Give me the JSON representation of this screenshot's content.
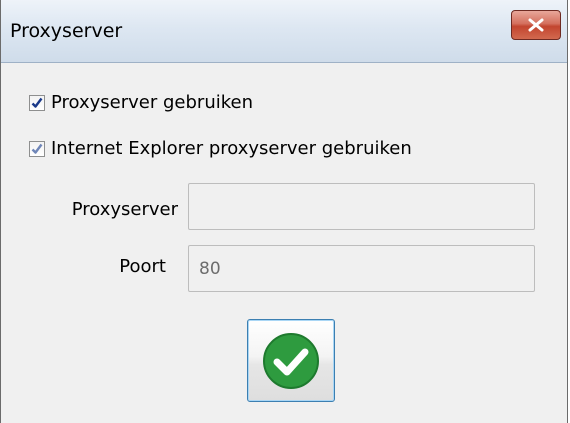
{
  "window": {
    "title": "Proxyserver",
    "close_icon": "close-icon"
  },
  "options": {
    "use_proxy": {
      "label": "Proxyserver gebruiken",
      "checked": true
    },
    "use_ie_proxy": {
      "label": "Internet Explorer proxyserver gebruiken",
      "checked": true,
      "disabled": true
    }
  },
  "fields": {
    "proxyserver": {
      "label": "Proxyserver",
      "value": ""
    },
    "port": {
      "label": "Poort",
      "value": "80"
    }
  },
  "actions": {
    "ok_icon": "checkmark-icon",
    "ok_color": "#2e9b3f"
  }
}
